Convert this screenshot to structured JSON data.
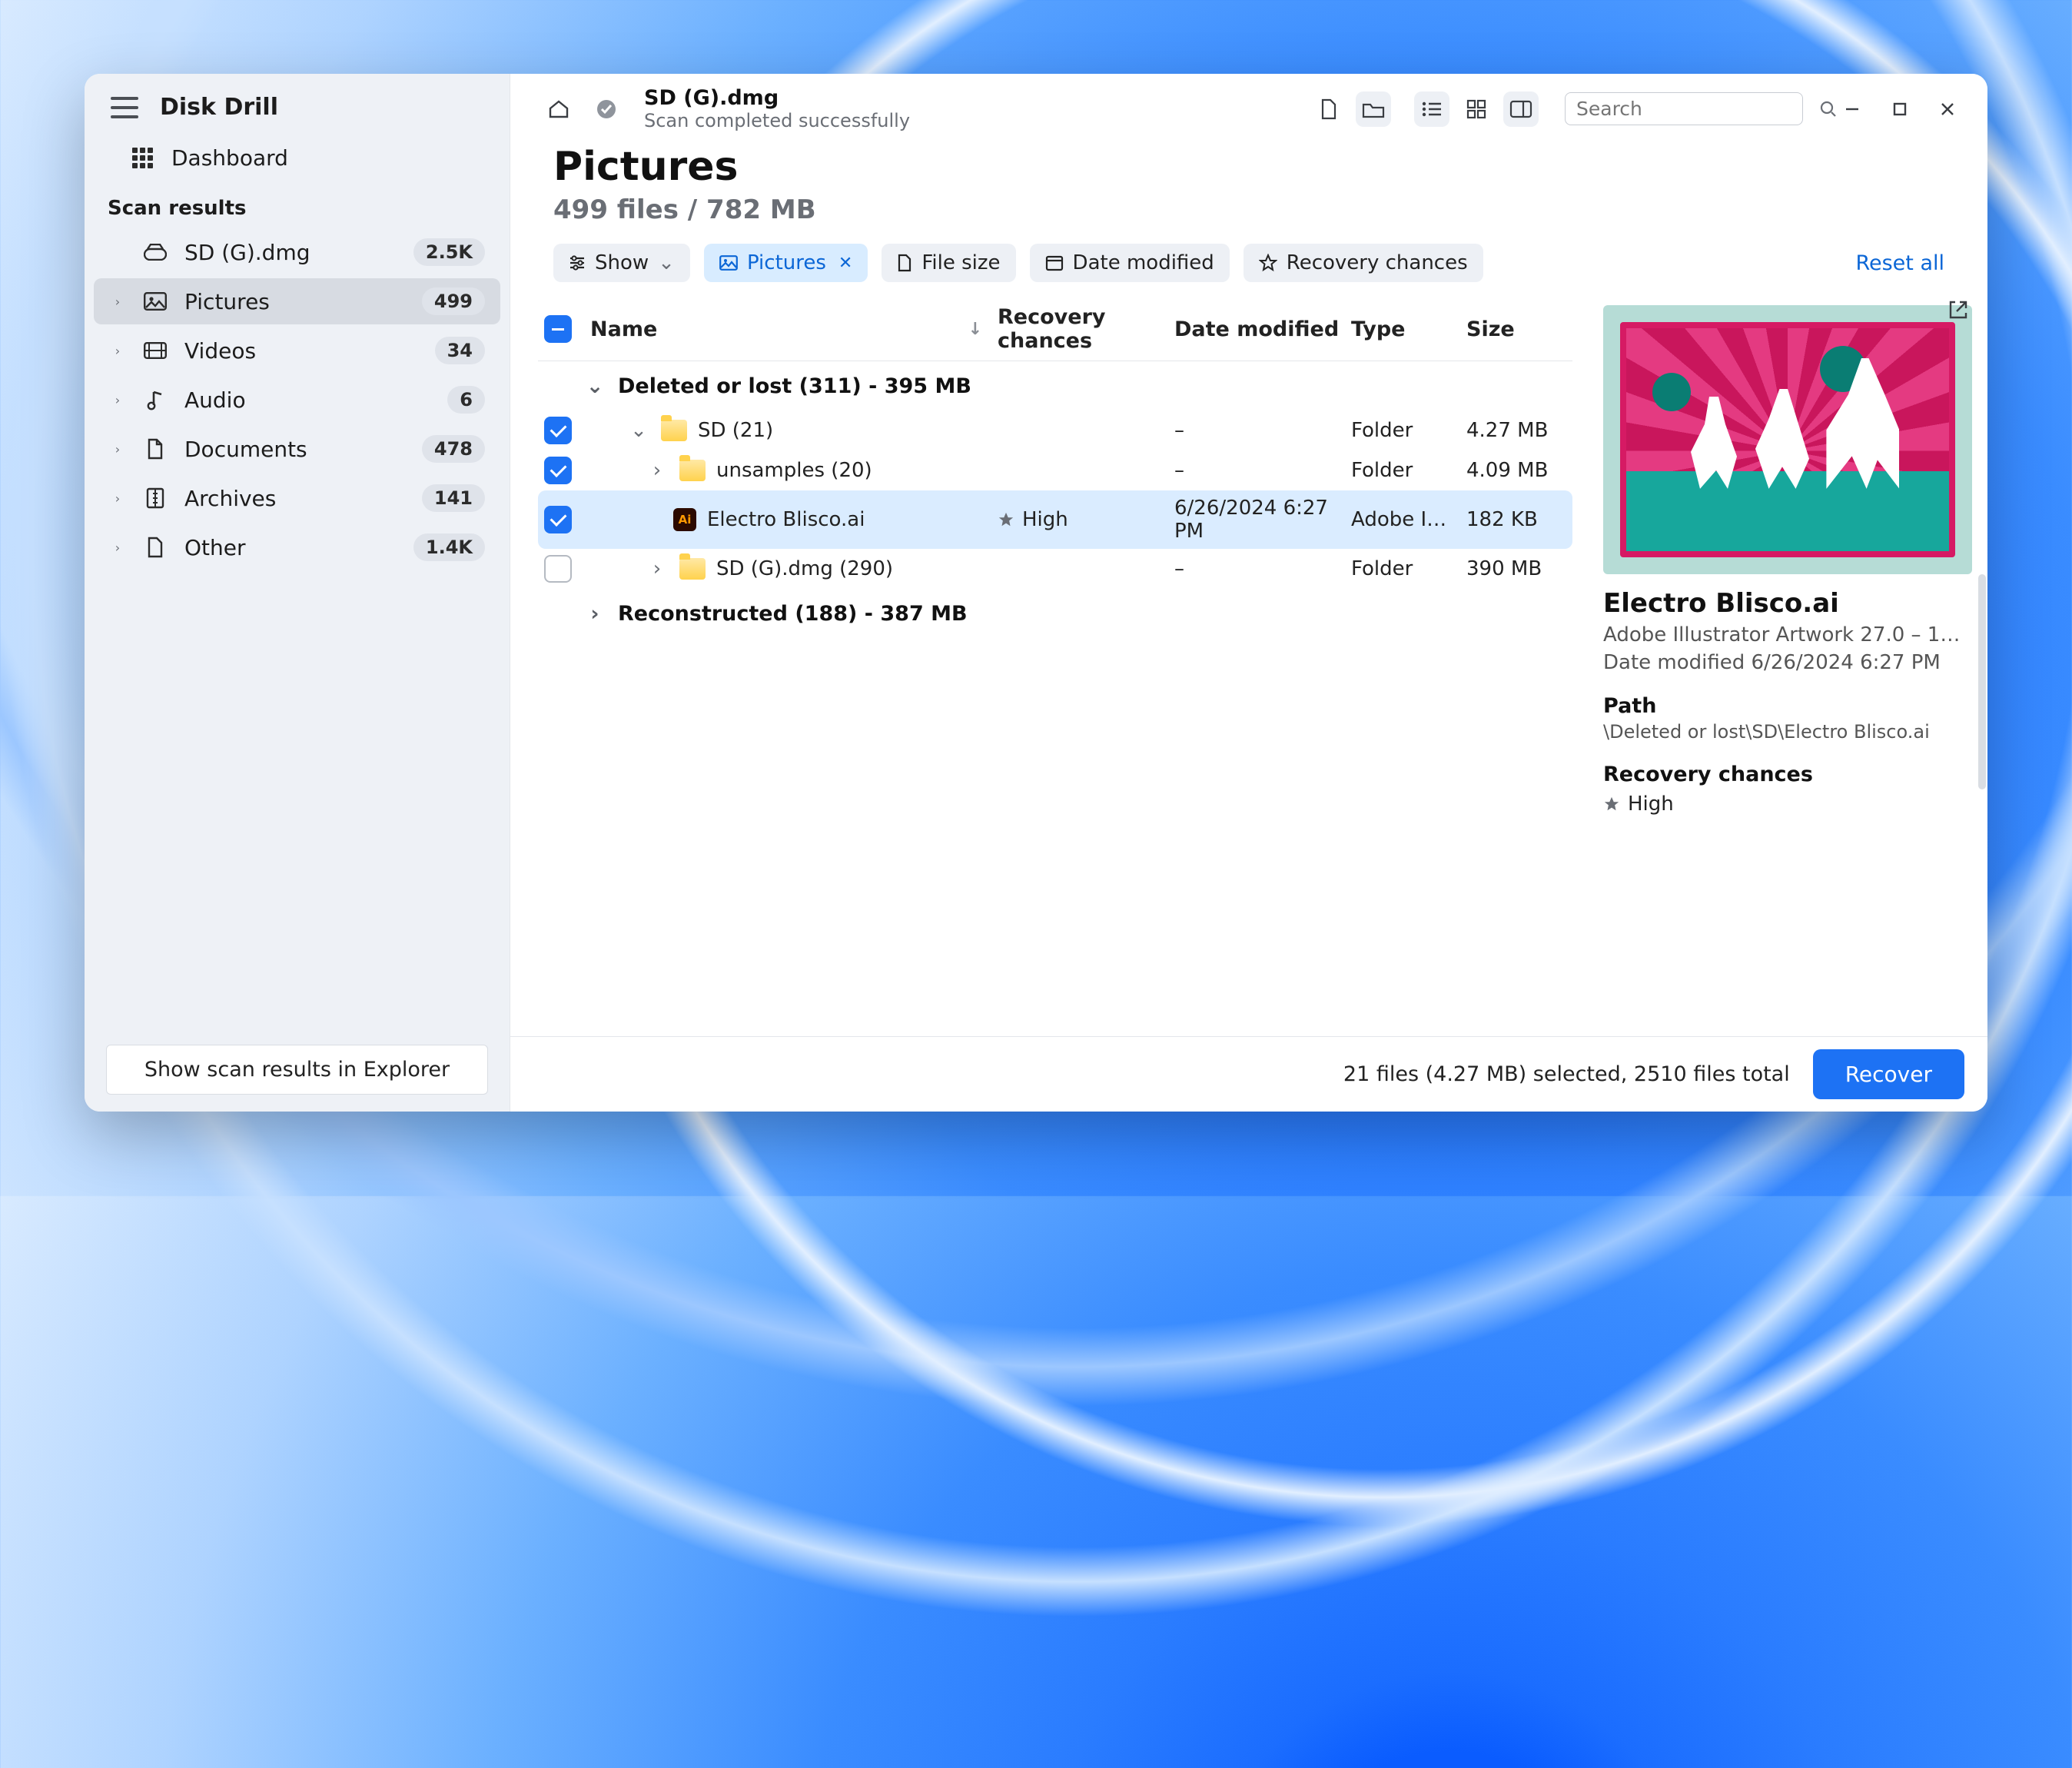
{
  "app": {
    "title": "Disk Drill"
  },
  "sidebar": {
    "dashboard_label": "Dashboard",
    "section_label": "Scan results",
    "device": {
      "label": "SD (G).dmg",
      "badge": "2.5K"
    },
    "items": [
      {
        "label": "Pictures",
        "badge": "499"
      },
      {
        "label": "Videos",
        "badge": "34"
      },
      {
        "label": "Audio",
        "badge": "6"
      },
      {
        "label": "Documents",
        "badge": "478"
      },
      {
        "label": "Archives",
        "badge": "141"
      },
      {
        "label": "Other",
        "badge": "1.4K"
      }
    ],
    "explorer_button": "Show scan results in Explorer"
  },
  "toolbar": {
    "title": "SD (G).dmg",
    "subtitle": "Scan completed successfully",
    "search_placeholder": "Search"
  },
  "page": {
    "title": "Pictures",
    "subtitle": "499 files / 782 MB"
  },
  "filters": {
    "show": "Show",
    "pictures": "Pictures",
    "filesize": "File size",
    "date": "Date modified",
    "recovery": "Recovery chances",
    "reset": "Reset all"
  },
  "columns": {
    "name": "Name",
    "recovery": "Recovery chances",
    "date": "Date modified",
    "type": "Type",
    "size": "Size"
  },
  "groups": {
    "deleted": "Deleted or lost (311) - 395 MB",
    "reconstructed": "Reconstructed (188) - 387 MB"
  },
  "rows": [
    {
      "name": "SD (21)",
      "recovery": "",
      "date": "–",
      "type": "Folder",
      "size": "4.27 MB",
      "checked": true,
      "depth": 1,
      "expand": "down",
      "icon": "folder"
    },
    {
      "name": "unsamples (20)",
      "recovery": "",
      "date": "–",
      "type": "Folder",
      "size": "4.09 MB",
      "checked": true,
      "depth": 2,
      "expand": "right",
      "icon": "folder"
    },
    {
      "name": "Electro Blisco.ai",
      "recovery": "High",
      "date": "6/26/2024 6:27 PM",
      "type": "Adobe I…",
      "size": "182 KB",
      "checked": true,
      "depth": 3,
      "expand": "",
      "icon": "ai",
      "selected": true
    },
    {
      "name": "SD (G).dmg (290)",
      "recovery": "",
      "date": "–",
      "type": "Folder",
      "size": "390 MB",
      "checked": false,
      "depth": 2,
      "expand": "right",
      "icon": "folder"
    }
  ],
  "preview": {
    "title": "Electro Blisco.ai",
    "type_line": "Adobe Illustrator Artwork 27.0 – 1…",
    "date_line": "Date modified 6/26/2024 6:27 PM",
    "path_label": "Path",
    "path_value": "\\Deleted or lost\\SD\\Electro Blisco.ai",
    "recovery_label": "Recovery chances",
    "recovery_value": "High"
  },
  "footer": {
    "status": "21 files (4.27 MB) selected, 2510 files total",
    "recover": "Recover"
  }
}
